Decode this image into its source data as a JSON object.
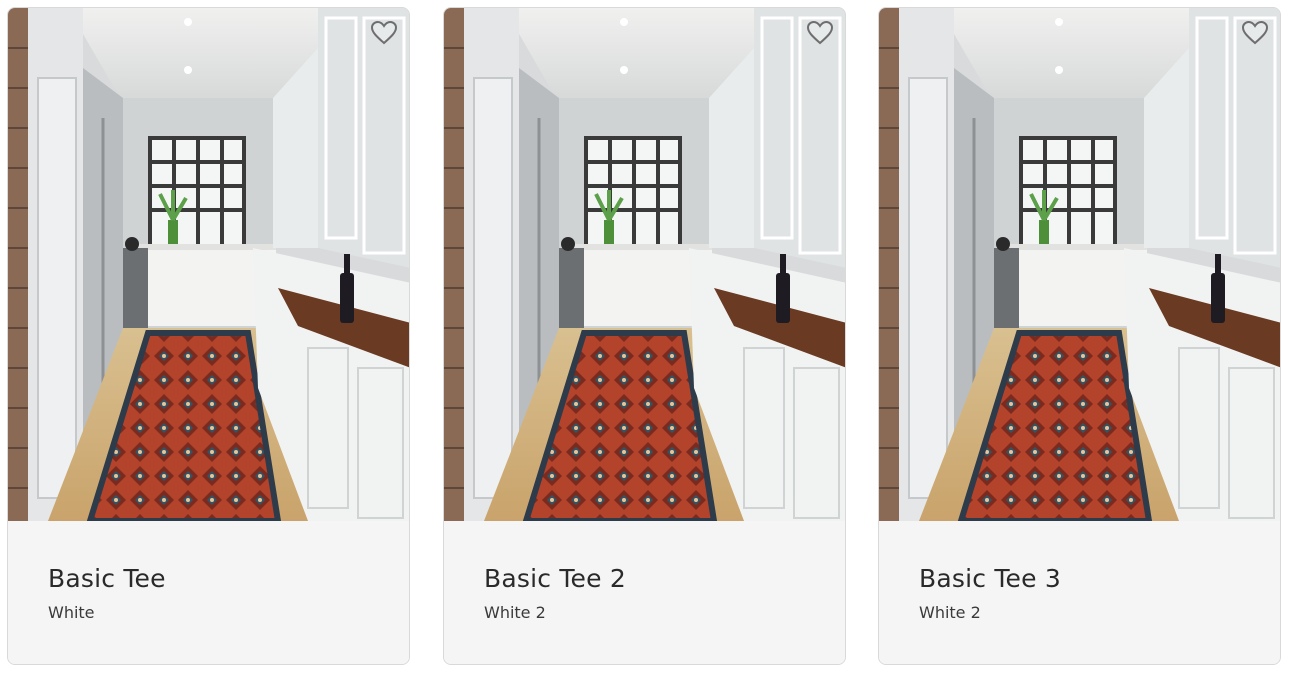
{
  "products": [
    {
      "title": "Basic Tee",
      "subtitle": "White"
    },
    {
      "title": "Basic Tee 2",
      "subtitle": "White 2"
    },
    {
      "title": "Basic Tee 3",
      "subtitle": "White 2"
    }
  ],
  "icons": {
    "favorite": "heart-outline-icon"
  },
  "colors": {
    "card_background": "#f5f5f5",
    "card_border": "#d9d9d9",
    "title_text": "#2a2a2a"
  }
}
